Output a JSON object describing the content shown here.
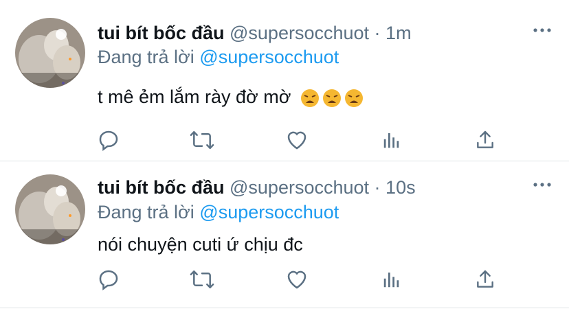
{
  "tweets": [
    {
      "display_name": "tui bít bốc đầu",
      "handle": "@supersocchuot",
      "separator": "·",
      "time": "1m",
      "replying_prefix": "Đang trả lời",
      "replying_to": "@supersocchuot",
      "text": "t mê ẻm lắm rày đờ mờ",
      "emojis": [
        "weary-face-icon",
        "weary-face-icon",
        "weary-face-icon"
      ]
    },
    {
      "display_name": "tui bít bốc đầu",
      "handle": "@supersocchuot",
      "separator": "·",
      "time": "10s",
      "replying_prefix": "Đang trả lời",
      "replying_to": "@supersocchuot",
      "text": "nói chuyện cuti ứ chịu đc",
      "emojis": []
    }
  ],
  "icons": [
    "reply-icon",
    "retweet-icon",
    "like-icon",
    "analytics-icon",
    "share-icon",
    "more-icon"
  ],
  "colors": {
    "link": "#1d9bf0",
    "muted": "#5b7083",
    "text": "#0f1419",
    "divider": "#dfe3e6"
  }
}
